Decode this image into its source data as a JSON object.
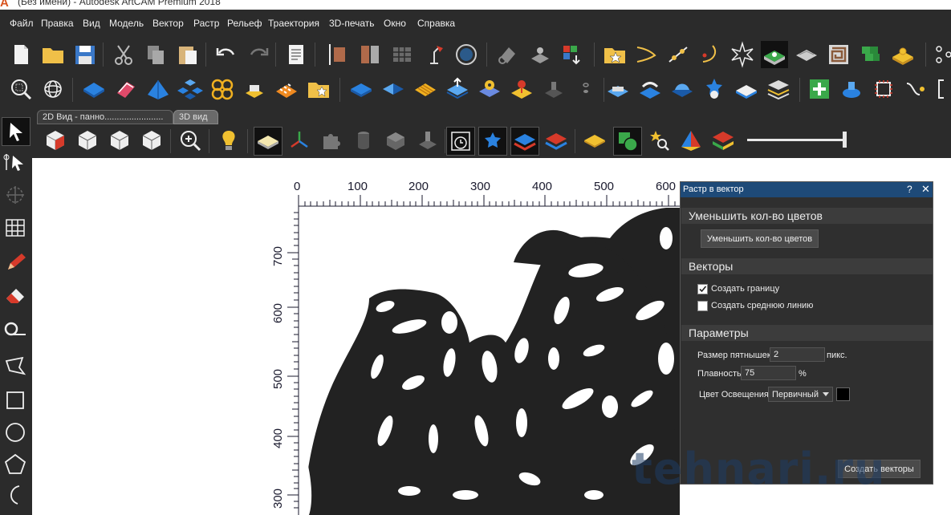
{
  "window": {
    "title": "(Без имени) - Autodesk ArtCAM Premium 2018",
    "app_icon": "artcam-logo-icon"
  },
  "menu": [
    "Файл",
    "Правка",
    "Вид",
    "Модель",
    "Вектор",
    "Растр",
    "Рельеф",
    "Траектория",
    "3D-печать",
    "Окно",
    "Справка"
  ],
  "tabs": [
    {
      "label": "2D Вид - панно........................"
    },
    {
      "label": "3D вид"
    }
  ],
  "canvas": {
    "x_ticks": [
      "0",
      "100",
      "200",
      "300",
      "400",
      "500",
      "600"
    ],
    "y_ticks": [
      "700",
      "600",
      "500",
      "400",
      "300"
    ]
  },
  "panel": {
    "title": "Растр в вектор",
    "help": "?",
    "close": "✕",
    "sections": {
      "reduce": "Уменьшить кол-во цветов",
      "vectors": "Векторы",
      "params": "Параметры"
    },
    "reduce_button": "Уменьшить кол-во цветов",
    "create_border": {
      "label": "Создать границу",
      "checked": true
    },
    "create_centerline": {
      "label": "Создать средню​ю линию",
      "checked": false
    },
    "spot_size": {
      "label": "Размер пятнышек",
      "value": "2",
      "unit": "пикс."
    },
    "smoothness": {
      "label": "Плавность",
      "value": "75",
      "unit": "%"
    },
    "light_color": {
      "label": "Цвет Освещения",
      "selected": "Первичный",
      "swatch": "#000000"
    },
    "create_button": "Создать векторы"
  },
  "watermark": "tehnari.ru",
  "colors": {
    "panel_header": "#1e4a78",
    "background": "#2b2b2b",
    "canvas": "#ffffff"
  }
}
